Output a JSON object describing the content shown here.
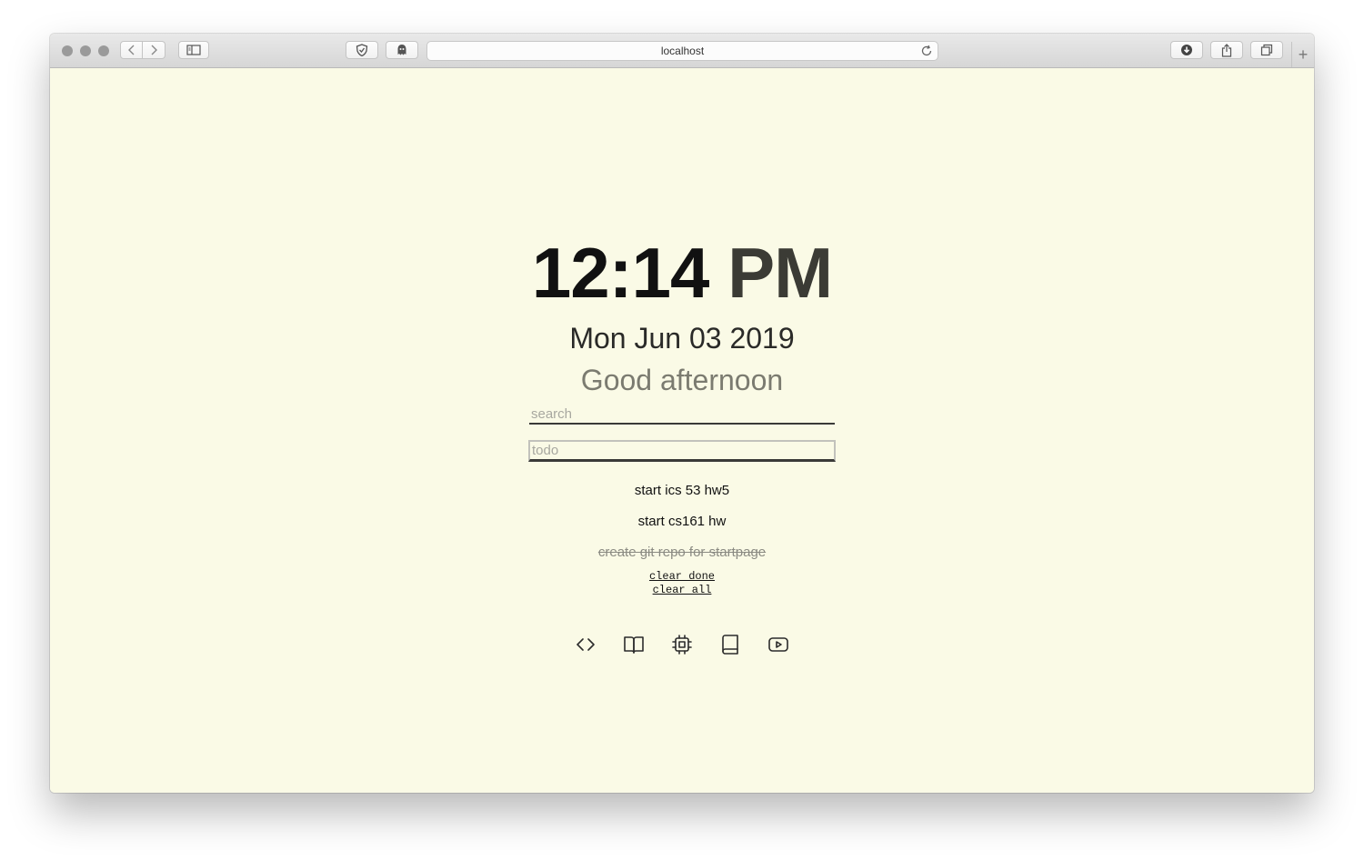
{
  "browser": {
    "url": "localhost",
    "icons": [
      "close-dot",
      "minimize-dot",
      "zoom-dot",
      "back-arrow-icon",
      "forward-arrow-icon",
      "sidebar-icon",
      "shield-icon",
      "ghostery-icon",
      "reload-icon",
      "download-icon",
      "share-icon",
      "tabs-icon",
      "plus-icon"
    ]
  },
  "clock": {
    "time": "12:14",
    "ampm": "PM"
  },
  "date": "Mon Jun 03 2019",
  "greeting": "Good afternoon",
  "search": {
    "placeholder": "search",
    "value": ""
  },
  "todo_input": {
    "placeholder": "todo",
    "value": ""
  },
  "todos": [
    {
      "text": "start ics 53 hw5",
      "done": false
    },
    {
      "text": "start cs161 hw",
      "done": false
    },
    {
      "text": "create git repo for startpage",
      "done": true
    }
  ],
  "actions": {
    "clear_done": "clear done",
    "clear_all": "clear all"
  },
  "shortcuts": [
    "code-icon",
    "book-open-icon",
    "cpu-icon",
    "book-icon",
    "youtube-icon"
  ],
  "colors": {
    "background": "#fafae6",
    "text": "#111111",
    "muted": "#7b7b70"
  }
}
